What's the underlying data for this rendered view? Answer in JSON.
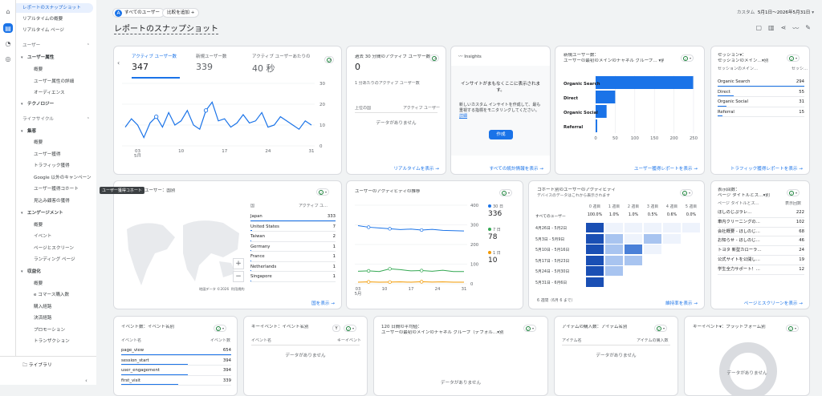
{
  "nav": {
    "items": [
      {
        "label": "レポートのスナップショット",
        "kind": "sel"
      },
      {
        "label": "リアルタイムの概要",
        "kind": "top"
      },
      {
        "label": "リアルタイム ページ",
        "kind": "top"
      },
      {
        "label": "ユーザー",
        "kind": "hd"
      },
      {
        "label": "ユーザー属性",
        "kind": "sec"
      },
      {
        "label": "概要",
        "kind": "sub"
      },
      {
        "label": "ユーザー属性の詳細",
        "kind": "sub"
      },
      {
        "label": "オーディエンス",
        "kind": "sub"
      },
      {
        "label": "テクノロジー",
        "kind": "sec"
      },
      {
        "label": "ライフサイクル",
        "kind": "hd"
      },
      {
        "label": "集客",
        "kind": "sec"
      },
      {
        "label": "概要",
        "kind": "sub"
      },
      {
        "label": "ユーザー獲得",
        "kind": "sub"
      },
      {
        "label": "トラフィック獲得",
        "kind": "sub"
      },
      {
        "label": "Google 以外のキャンペーン",
        "kind": "sub"
      },
      {
        "label": "ユーザー獲得コホート",
        "kind": "sub"
      },
      {
        "label": "見込み顧客の獲得",
        "kind": "sub"
      },
      {
        "label": "エンゲージメント",
        "kind": "sec"
      },
      {
        "label": "概要",
        "kind": "sub"
      },
      {
        "label": "イベント",
        "kind": "sub"
      },
      {
        "label": "ページとスクリーン",
        "kind": "sub"
      },
      {
        "label": "ランディング ページ",
        "kind": "sub"
      },
      {
        "label": "収益化",
        "kind": "sec"
      },
      {
        "label": "概要",
        "kind": "sub"
      },
      {
        "label": "e コマース購入数",
        "kind": "sub"
      },
      {
        "label": "購入経路",
        "kind": "sub"
      },
      {
        "label": "決済経路",
        "kind": "sub"
      },
      {
        "label": "プロモーション",
        "kind": "sub"
      },
      {
        "label": "トランザクション",
        "kind": "sub"
      }
    ],
    "library": "ライブラリ",
    "tooltip": "ユーザー獲得コホート"
  },
  "topbar": {
    "all_users": "すべてのユーザー",
    "compare": "比較を追加",
    "date_label": "カスタム",
    "date_range": "5月1日～2026年5月31日"
  },
  "page_title": "レポートのスナップショット",
  "overview": {
    "metrics": [
      {
        "label": "アクティブ ユーザー数",
        "value": "347"
      },
      {
        "label": "新規ユーザー数",
        "value": "339"
      },
      {
        "label": "アクティブ ユーザーあたりの",
        "value": "40 秒"
      }
    ],
    "y_ticks": [
      "30",
      "20",
      "10",
      "0"
    ],
    "x_ticks": [
      "03\n5月",
      "10",
      "17",
      "24",
      "31"
    ]
  },
  "realtime": {
    "title": "過去 30 分間のアクティブ ユーザー数",
    "value": "0",
    "sub": "1 分あたりのアクティブ ユーザー数",
    "col1": "上位の国",
    "col2": "アクティブ ユーザー",
    "empty": "データがありません",
    "link": "リアルタイムを表示"
  },
  "insights": {
    "title": "Insights",
    "head": "インサイトがまもなくここに表示されます。",
    "body": "新しいカスタム インサイトを作成して、最も重視する指標をモニタリングしてください。",
    "detail": "詳細",
    "button": "作成",
    "link": "すべての統計情報を表示"
  },
  "newusers": {
    "title": "新規ユーザー数：",
    "subtitle": "ユーザーの最初のメインのチャネル グループ… ▾別",
    "link": "ユーザー獲得レポートを表示"
  },
  "sessions": {
    "title": "セッション▾：",
    "subtitle": "セッションのメイン…▾別",
    "col1": "セッションのメイン…",
    "col2": "セッシ…",
    "rows": [
      {
        "name": "Organic Search",
        "value": "294"
      },
      {
        "name": "Direct",
        "value": "55"
      },
      {
        "name": "Organic Social",
        "value": "31"
      },
      {
        "name": "Referral",
        "value": "15"
      }
    ],
    "link": "トラフィック獲得レポートを表示"
  },
  "country": {
    "title": "ユーザー：国別",
    "col1": "国",
    "col2": "アクティブ ユ…",
    "rows": [
      {
        "name": "Japan",
        "value": "333"
      },
      {
        "name": "United States",
        "value": "7"
      },
      {
        "name": "Taiwan",
        "value": "2"
      },
      {
        "name": "Germany",
        "value": "1"
      },
      {
        "name": "France",
        "value": "1"
      },
      {
        "name": "Netherlands",
        "value": "1"
      },
      {
        "name": "Singapore",
        "value": "1"
      }
    ],
    "map_note": "地図データ ©2026",
    "map_terms": "利用規約",
    "link": "国を表示"
  },
  "activity": {
    "title": "ユーザーのアクティビティの推移",
    "legend": [
      {
        "label": "30 日",
        "value": "336",
        "color": "#1a73e8"
      },
      {
        "label": "7 日",
        "value": "78",
        "color": "#34a853"
      },
      {
        "label": "1 日",
        "value": "10",
        "color": "#f29900"
      }
    ],
    "y_ticks": [
      "400",
      "300",
      "200",
      "100",
      "0"
    ],
    "x_ticks": [
      "03\n5月",
      "10",
      "17",
      "24",
      "31"
    ]
  },
  "cohort": {
    "title": "コホート別のユーザーのアクティビティ",
    "subtitle": "デバイスのデータはこれから表示されます",
    "cols": [
      "0 週目",
      "1 週目",
      "2 週目",
      "3 週目",
      "4 週目",
      "5 週目"
    ],
    "all_label": "すべてのユーザー",
    "all_vals": [
      "100.0%",
      "1.0%",
      "1.0%",
      "0.5%",
      "0.6%",
      "0.0%"
    ],
    "rows": [
      "4月26日 - 5月2日",
      "5月3日 - 5月9日",
      "5月10日 - 5月16日",
      "5月17日 - 5月23日",
      "5月24日 - 5月30日",
      "5月31日 - 6月6日"
    ],
    "footer": "6 週間（6月 6 まで）",
    "link": "維持率を表示"
  },
  "pages": {
    "title": "表示回数：",
    "subtitle": "ページ タイトルとス…▾別",
    "col1": "ページ タイトルとス…",
    "col2": "表示回数",
    "rows": [
      {
        "name": "ほしのじぷラレ…",
        "value": "222"
      },
      {
        "name": "車内クリーニングの…",
        "value": "102"
      },
      {
        "name": "会社概要 - ほしのじ…",
        "value": "68"
      },
      {
        "name": "お知らせ - ほしのじ…",
        "value": "46"
      },
      {
        "name": "トヨタ 新型カローラ…",
        "value": "24"
      },
      {
        "name": "公式サイトを公開し…",
        "value": "19"
      },
      {
        "name": "学生全力サポート！…",
        "value": "12"
      }
    ],
    "link": "ページとスクリーンを表示"
  },
  "events": {
    "title": "イベント数：イベント名別",
    "col1": "イベント名",
    "col2": "イベント数",
    "rows": [
      {
        "name": "page_view",
        "value": "654"
      },
      {
        "name": "session_start",
        "value": "394"
      },
      {
        "name": "user_engagement",
        "value": "394"
      },
      {
        "name": "first_visit",
        "value": "339"
      }
    ]
  },
  "keyevents": {
    "title": "キーイベント：イベント名別",
    "col1": "イベント名",
    "col2": "キーイベント",
    "empty": "データがありません"
  },
  "avg120": {
    "title": "120 日間の平均値：",
    "subtitle": "ユーザーの最初のメインのチャネル グループ（デフォル…▾別",
    "empty": "データがありません"
  },
  "purchases": {
    "title": "アイテムの購入数：アイテム名別",
    "col1": "アイテム名",
    "col2": "アイテムの購入数",
    "empty": "データがありません"
  },
  "platform": {
    "title": "キーイベント▾：プラットフォーム別",
    "empty": "データがありません"
  },
  "chart_data": [
    {
      "type": "line",
      "title": "アクティブ ユーザー数",
      "x": [
        "5/1",
        "5/2",
        "5/3",
        "5/4",
        "5/5",
        "5/6",
        "5/7",
        "5/8",
        "5/9",
        "5/10",
        "5/11",
        "5/12",
        "5/13",
        "5/14",
        "5/15",
        "5/16",
        "5/17",
        "5/18",
        "5/19",
        "5/20",
        "5/21",
        "5/22",
        "5/23",
        "5/24",
        "5/25",
        "5/26",
        "5/27",
        "5/28",
        "5/29",
        "5/30",
        "5/31"
      ],
      "series": [
        {
          "name": "アクティブ ユーザー数",
          "values": [
            9,
            13,
            10,
            4,
            11,
            14,
            9,
            16,
            10,
            12,
            17,
            10,
            8,
            17,
            21,
            12,
            13,
            9,
            11,
            15,
            11,
            12,
            16,
            9,
            10,
            14,
            12,
            10,
            8,
            12,
            10
          ]
        }
      ],
      "ylim": [
        0,
        30
      ],
      "color": "#1a73e8"
    },
    {
      "type": "bar",
      "orientation": "horizontal",
      "categories": [
        "Organic Search",
        "Direct",
        "Organic Social",
        "Referral"
      ],
      "values": [
        249,
        50,
        28,
        4
      ],
      "xlim": [
        0,
        250
      ],
      "x_ticks": [
        "0",
        "50",
        "100",
        "150",
        "200",
        "250"
      ],
      "color": "#1a73e8"
    },
    {
      "type": "line",
      "title": "ユーザーのアクティビティの推移",
      "x": [
        "5/1",
        "5/4",
        "5/7",
        "5/10",
        "5/13",
        "5/16",
        "5/19",
        "5/22",
        "5/25",
        "5/28",
        "5/31"
      ],
      "series": [
        {
          "name": "30 日",
          "values": [
            370,
            360,
            355,
            350,
            345,
            348,
            342,
            346,
            340,
            338,
            336
          ]
        },
        {
          "name": "7 日",
          "values": [
            80,
            82,
            78,
            95,
            90,
            82,
            84,
            80,
            86,
            78,
            78
          ]
        },
        {
          "name": "1 日",
          "values": [
            10,
            12,
            10,
            11,
            12,
            10,
            13,
            11,
            12,
            10,
            10
          ]
        }
      ],
      "ylim": [
        0,
        500
      ]
    },
    {
      "type": "heatmap",
      "rows": 6,
      "cols": 6,
      "values": [
        [
          1,
          0,
          0,
          0,
          0,
          0
        ],
        [
          1,
          0.4,
          0,
          0.4,
          0,
          0
        ],
        [
          1,
          0.6,
          0.8,
          0,
          0,
          0
        ],
        [
          1,
          0.6,
          0.6,
          0,
          0,
          0
        ],
        [
          1,
          0.5,
          0,
          0,
          0,
          0
        ],
        [
          1,
          0,
          0,
          0,
          0,
          0
        ]
      ]
    }
  ]
}
